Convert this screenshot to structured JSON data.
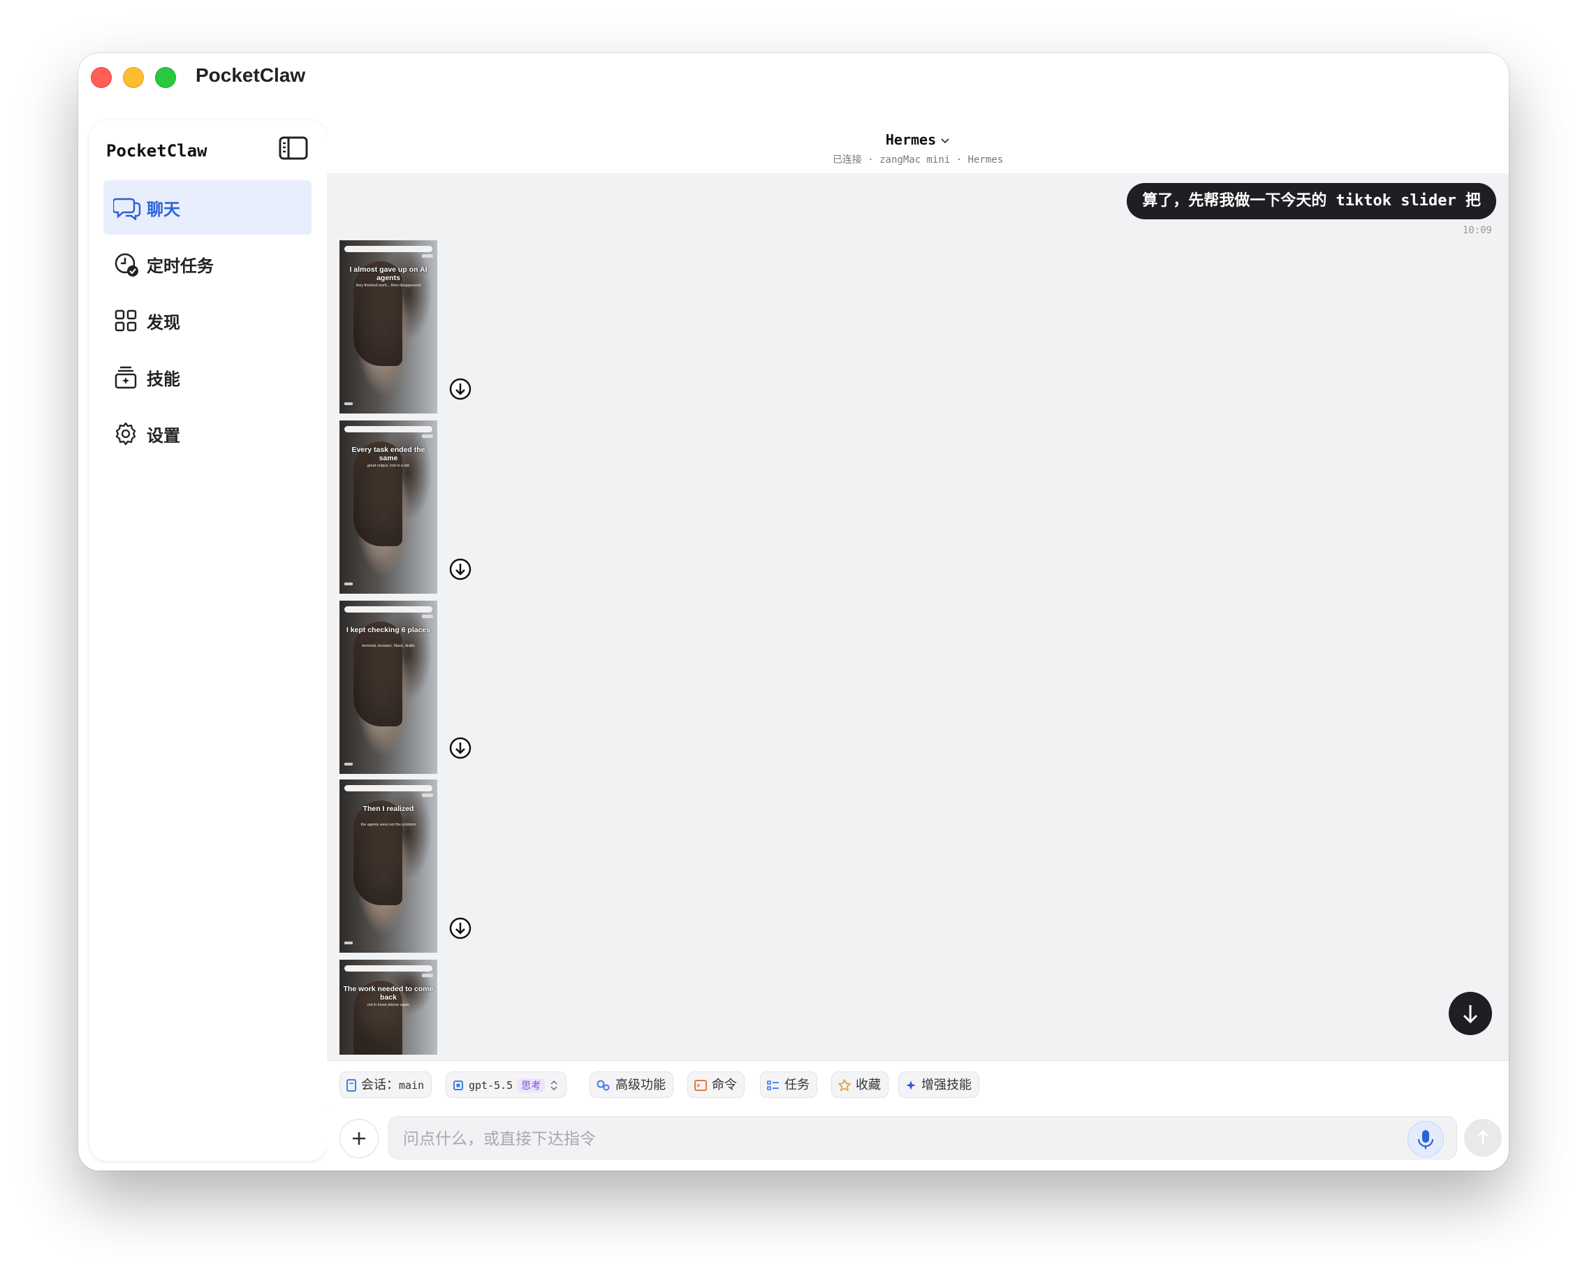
{
  "app": {
    "title": "PocketClaw"
  },
  "sidebar": {
    "title": "PocketClaw",
    "items": [
      {
        "label": "聊天",
        "icon": "chat-icon",
        "active": true
      },
      {
        "label": "定时任务",
        "icon": "clock-check-icon",
        "active": false
      },
      {
        "label": "发现",
        "icon": "grid-icon",
        "active": false
      },
      {
        "label": "技能",
        "icon": "skills-icon",
        "active": false
      },
      {
        "label": "设置",
        "icon": "gear-icon",
        "active": false
      }
    ]
  },
  "header": {
    "title": "Hermes",
    "status": "已连接",
    "device": "zangMac mini",
    "agent": "Hermes",
    "sep1": " · ",
    "sep2": " · "
  },
  "chat": {
    "user_message": "算了，先帮我做一下今天的 tiktok slider 把",
    "user_time": "10:09",
    "slides": [
      {
        "caption": "I almost gave up on AI agents",
        "subcaption": "they finished work... then disappeared"
      },
      {
        "caption": "Every task ended the same",
        "subcaption": "great output, lost in a tab"
      },
      {
        "caption": "I kept checking 6 places",
        "subcaption": "terminal, browser, Slack, drafts"
      },
      {
        "caption": "Then I realized",
        "subcaption": "the agents were not the problem"
      },
      {
        "caption": "The work needed to come back",
        "subcaption": "not in loose places again"
      }
    ]
  },
  "toolbar": {
    "session_label": "会话：",
    "session_value": "main",
    "model": "gpt-5.5",
    "model_tag": "思考",
    "advanced": "高级功能",
    "command": "命令",
    "tasks": "任务",
    "favorites": "收藏",
    "enhance": "增强技能"
  },
  "composer": {
    "placeholder": "问点什么，或直接下达指令",
    "value": ""
  },
  "colors": {
    "accent": "#2b62d9",
    "active_bg": "#e8eefc",
    "chat_bg": "#f1f2f4",
    "bubble": "#1e1f22",
    "model_tag_bg": "#ece4fb",
    "model_tag_fg": "#7a55d1"
  }
}
